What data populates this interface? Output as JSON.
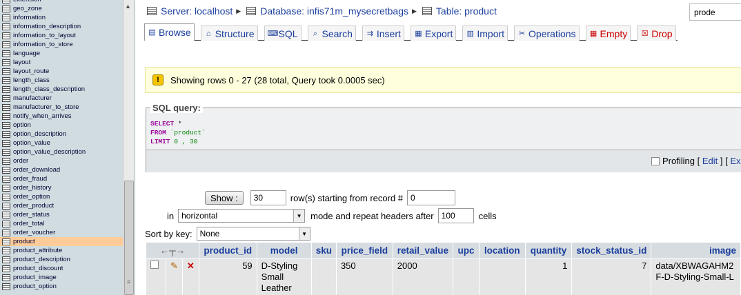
{
  "sidebar": {
    "tables": [
      "extension",
      "geo_zone",
      "information",
      "information_description",
      "information_to_layout",
      "information_to_store",
      "language",
      "layout",
      "layout_route",
      "length_class",
      "length_class_description",
      "manufacturer",
      "manufacturer_to_store",
      "notify_when_arrives",
      "option",
      "option_description",
      "option_value",
      "option_value_description",
      "order",
      "order_download",
      "order_fraud",
      "order_history",
      "order_option",
      "order_product",
      "order_status",
      "order_total",
      "order_voucher",
      "product",
      "product_attribute",
      "product_description",
      "product_discount",
      "product_image",
      "product_option"
    ],
    "active": "product"
  },
  "breadcrumb": {
    "server": "Server: localhost",
    "database": "Database: infis71m_mysecretbags",
    "table": "Table: product"
  },
  "search": {
    "value": "prode"
  },
  "tabs": [
    {
      "label": "Browse",
      "icon": "browse-icon"
    },
    {
      "label": "Structure",
      "icon": "structure-icon"
    },
    {
      "label": "SQL",
      "icon": "sql-icon"
    },
    {
      "label": "Search",
      "icon": "search-icon"
    },
    {
      "label": "Insert",
      "icon": "insert-icon"
    },
    {
      "label": "Export",
      "icon": "export-icon"
    },
    {
      "label": "Import",
      "icon": "import-icon"
    },
    {
      "label": "Operations",
      "icon": "operations-icon"
    },
    {
      "label": "Empty",
      "icon": "empty-icon"
    },
    {
      "label": "Drop",
      "icon": "drop-icon"
    }
  ],
  "notice": {
    "text": "Showing rows 0 - 27 (28 total, Query took 0.0005 sec)"
  },
  "sql": {
    "legend": "SQL query:",
    "select_kw": "SELECT",
    "select_rest": " *",
    "from_kw": "FROM",
    "from_rest": " `product`",
    "limit_kw": "LIMIT",
    "limit_rest": " 0 , 30",
    "profiling": "Profiling",
    "edit": "Edit",
    "bracket_open": "[",
    "bracket_close": "]",
    "next_link": "Ex"
  },
  "navigation": {
    "show_label": "Show :",
    "rows": "30",
    "rows_text": "row(s) starting from record #",
    "start": "0",
    "in_label": "in",
    "mode": "horizontal",
    "mode_text": "mode and repeat headers after",
    "repeat": "100",
    "cells_text": "cells",
    "sort_label": "Sort by key:",
    "sort_value": "None"
  },
  "table": {
    "columns": [
      "product_id",
      "model",
      "sku",
      "price_field",
      "retail_value",
      "upc",
      "location",
      "quantity",
      "stock_status_id",
      "image"
    ],
    "row": {
      "product_id": "59",
      "model": "D-Styling Small Leather",
      "sku": "",
      "price_field": "350",
      "retail_value": "2000",
      "upc": "",
      "location": "",
      "quantity": "1",
      "stock_status_id": "7",
      "image": "data/XBWAGAHM2 F-D-Styling-Small-L"
    }
  },
  "colors": {
    "link": "#1a3e9c",
    "sidebar_bg": "#d0dce0",
    "active_row": "#ffcc99",
    "notice_bg": "#ffffdd"
  }
}
